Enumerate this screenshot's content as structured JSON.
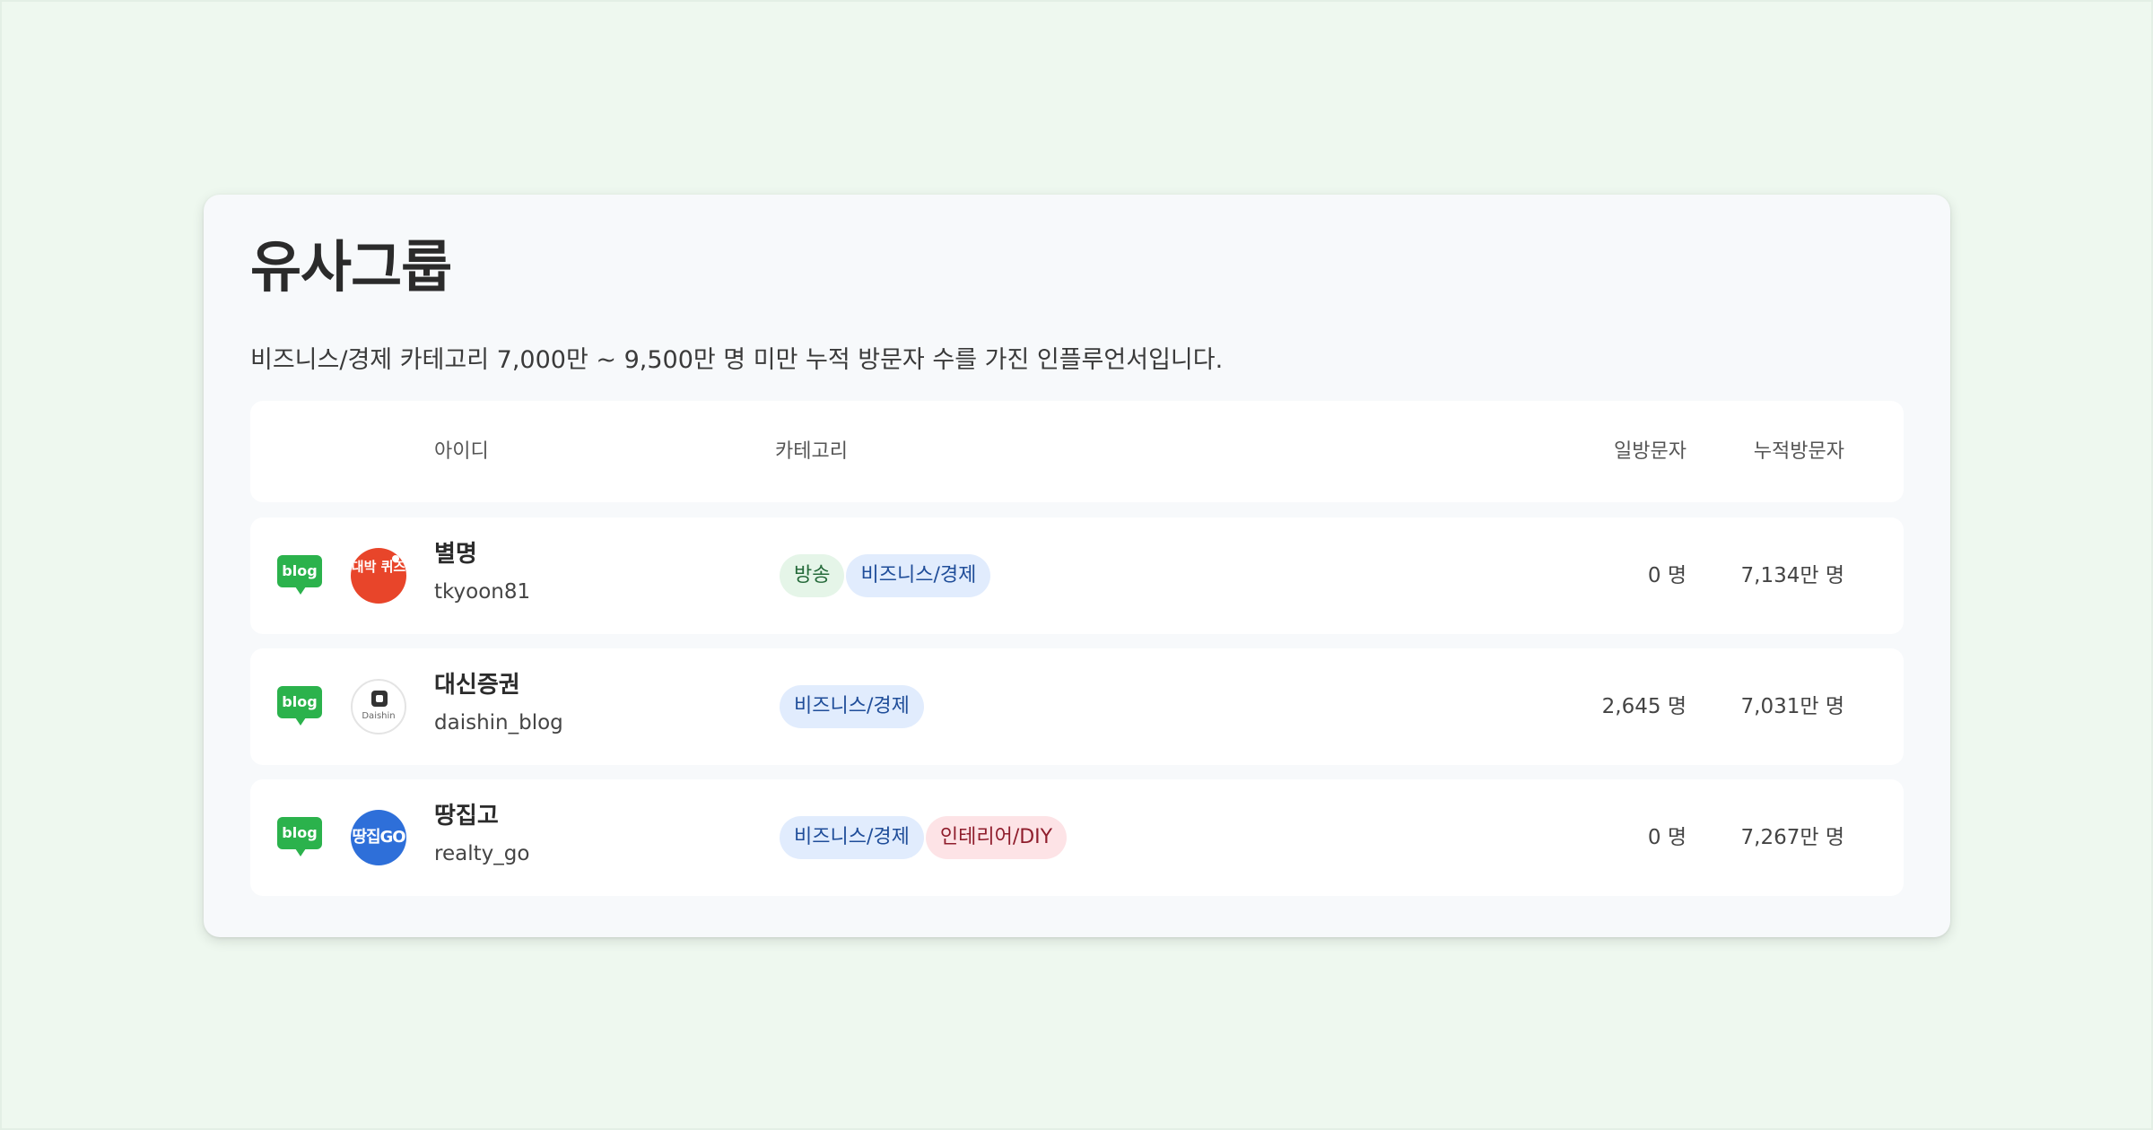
{
  "title": "유사그룹",
  "subtitle": "비즈니스/경제 카테고리 7,000만 ~ 9,500만 명 미만 누적 방문자 수를 가진 인플루언서입니다.",
  "columns": {
    "id": "아이디",
    "category": "카테고리",
    "daily": "일방문자",
    "total": "누적방문자"
  },
  "rows": [
    {
      "platform": "blog",
      "avatar_text": "대박 퀴즈",
      "nickname": "별명",
      "user_id": "tkyoon81",
      "tags": [
        "방송",
        "비즈니스/경제"
      ],
      "daily": "0 명",
      "total": "7,134만 명"
    },
    {
      "platform": "blog",
      "avatar_text": "Daishin",
      "nickname": "대신증권",
      "user_id": "daishin_blog",
      "tags": [
        "비즈니스/경제"
      ],
      "daily": "2,645 명",
      "total": "7,031만 명"
    },
    {
      "platform": "blog",
      "avatar_text": "땅집GO",
      "nickname": "땅집고",
      "user_id": "realty_go",
      "tags": [
        "비즈니스/경제",
        "인테리어/DIY"
      ],
      "daily": "0 명",
      "total": "7,267만 명"
    }
  ],
  "colors": {
    "background": "#eef8ef",
    "card": "#f7f9fb",
    "blog_green": "#2bb24c",
    "tag_green": "#e5f5e8",
    "tag_blue": "#e1ecfd",
    "tag_red": "#fde3e6"
  },
  "icons": {
    "platform": "blog-icon"
  }
}
